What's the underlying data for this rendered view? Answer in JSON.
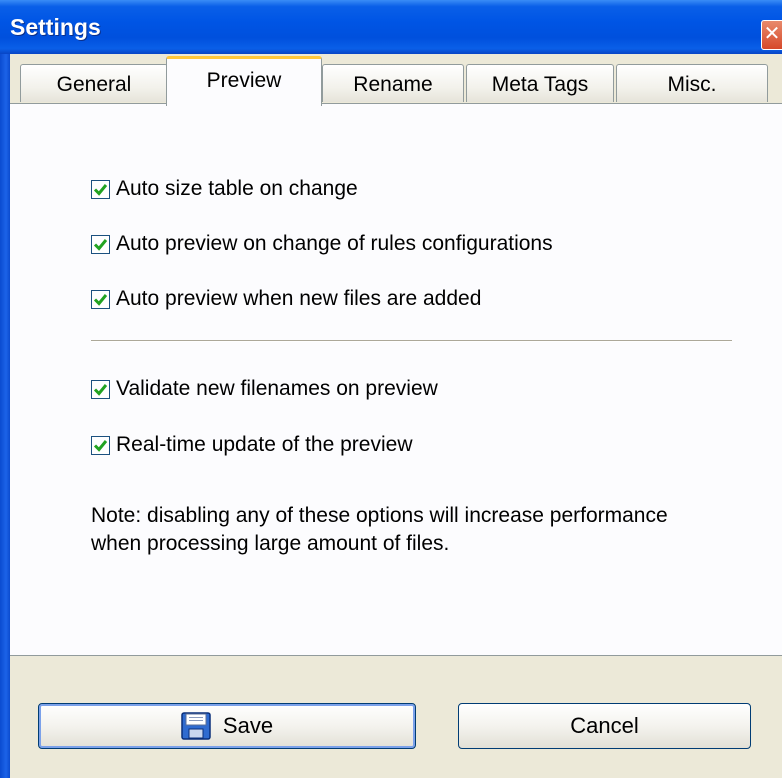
{
  "window": {
    "title": "Settings",
    "close_glyph": "✕"
  },
  "tabs": [
    {
      "label": "General",
      "active": false
    },
    {
      "label": "Preview",
      "active": true
    },
    {
      "label": "Rename",
      "active": false
    },
    {
      "label": "Meta Tags",
      "active": false
    },
    {
      "label": "Misc.",
      "active": false
    }
  ],
  "options": [
    {
      "label": "Auto size table on change",
      "checked": true
    },
    {
      "label": "Auto preview on change of rules configurations",
      "checked": true
    },
    {
      "label": "Auto preview when new files are added",
      "checked": true
    },
    {
      "label": "Validate new filenames on preview",
      "checked": true
    },
    {
      "label": "Real-time update of the preview",
      "checked": true
    }
  ],
  "note": "Note: disabling any of these options will increase performance when processing large amount of files.",
  "buttons": {
    "save_label": "Save",
    "cancel_label": "Cancel",
    "save_icon": "floppy-disk-icon"
  },
  "colors": {
    "titlebar": "#0055e5",
    "active_tab_accent": "#ffc83c",
    "check": "#22a322",
    "close": "#d6492a"
  }
}
